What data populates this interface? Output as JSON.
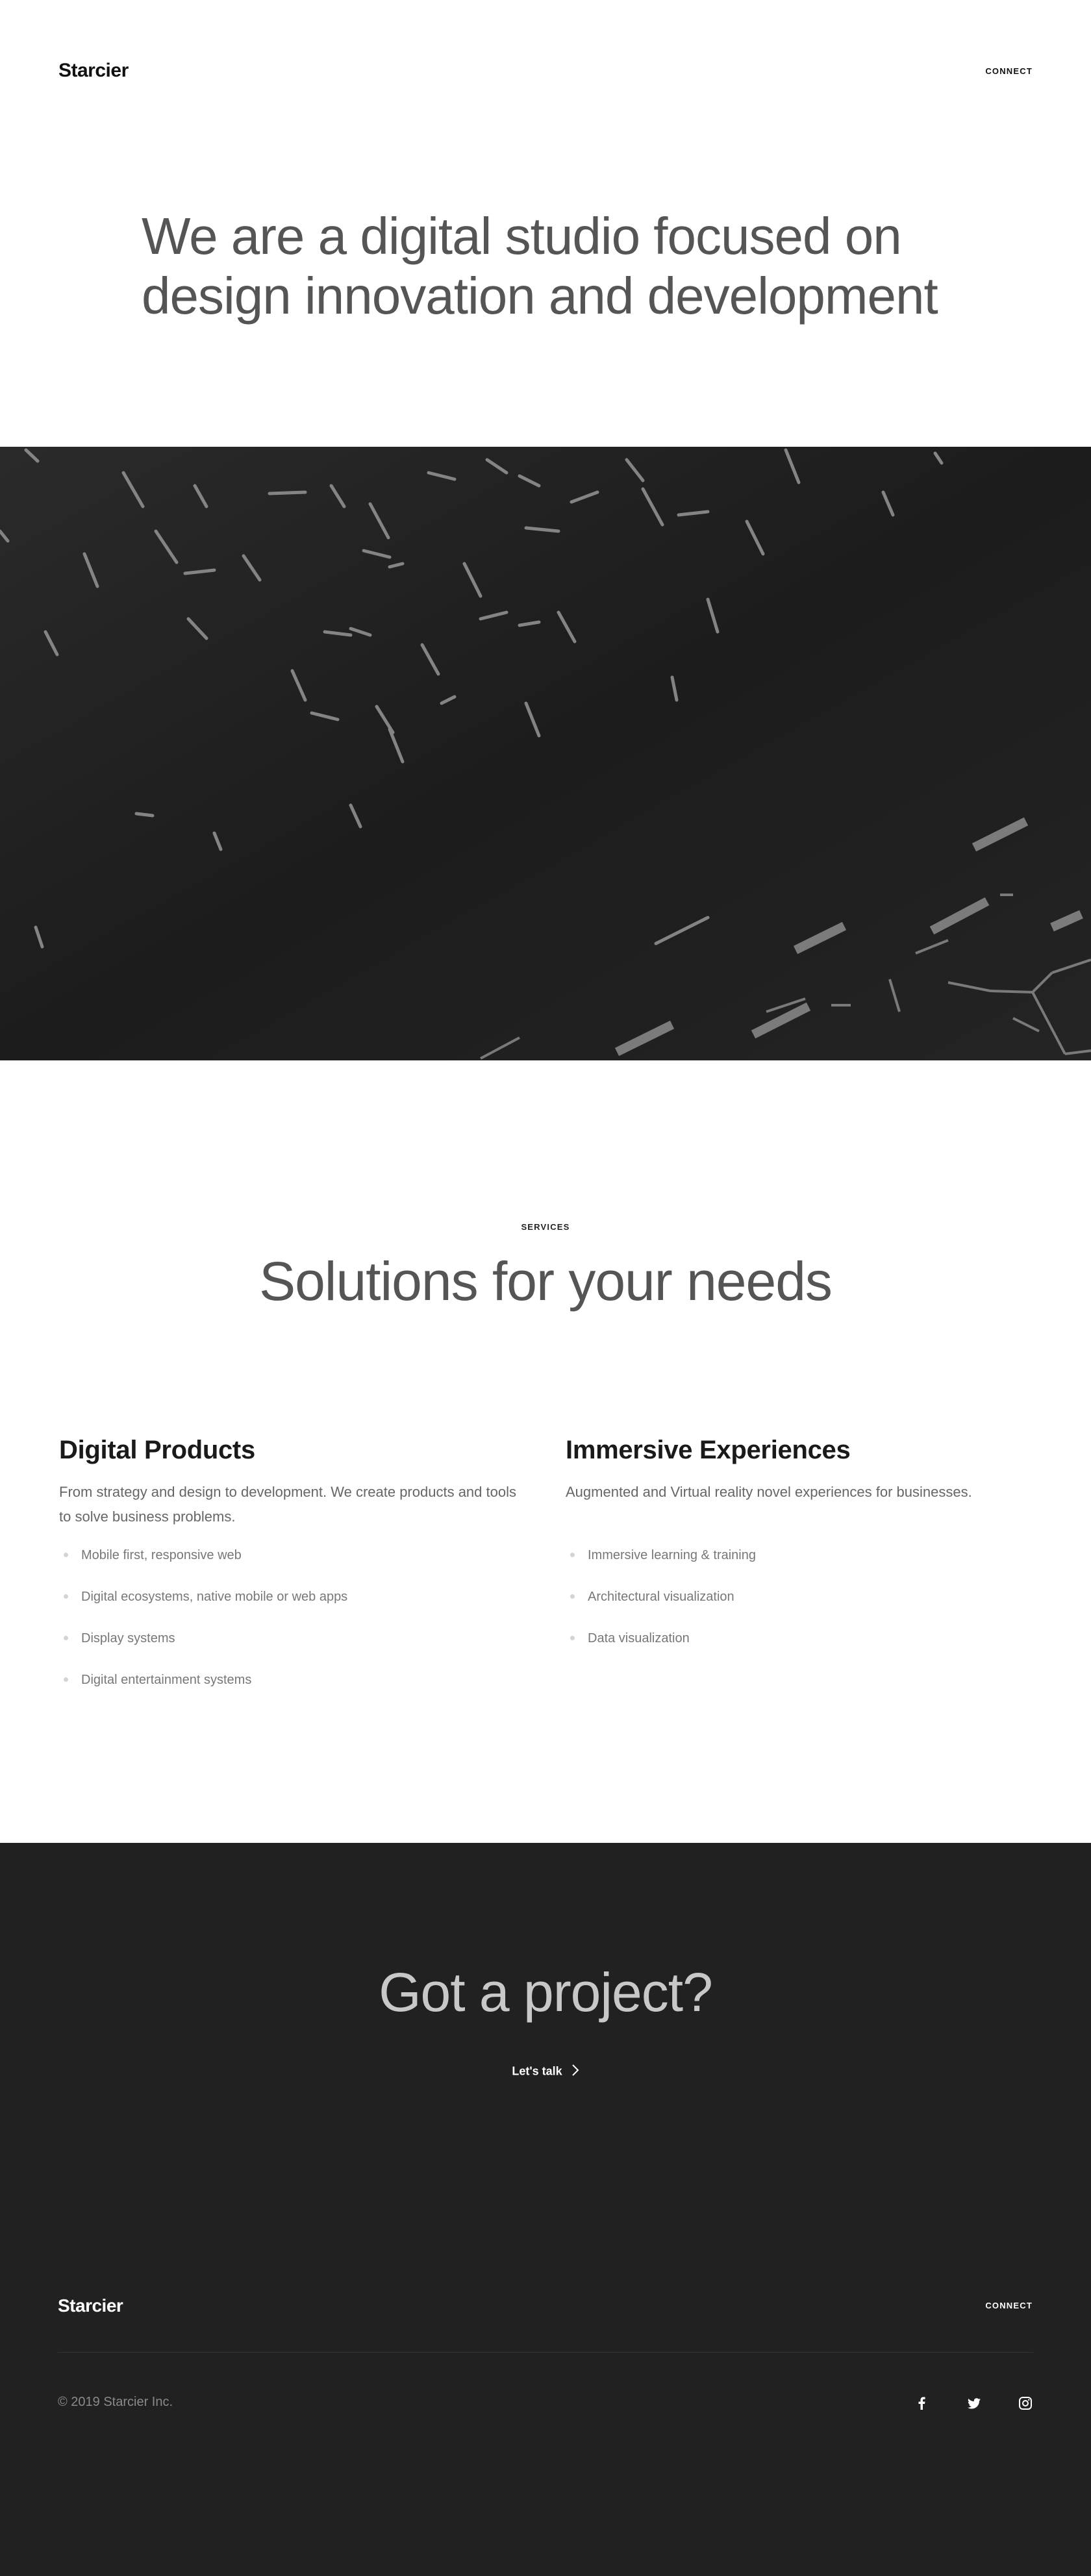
{
  "header": {
    "logo": "Starcier",
    "connect": "CONNECT"
  },
  "hero": {
    "line1": "We are a digital studio focused on",
    "line2": "design innovation and development"
  },
  "services": {
    "eyebrow": "SERVICES",
    "title": "Solutions for your needs",
    "columns": [
      {
        "title": "Digital Products",
        "description": "From strategy and design to development. We create products and tools to solve business problems.",
        "items": [
          "Mobile first, responsive web",
          "Digital ecosystems, native mobile or web apps",
          "Display systems",
          "Digital entertainment systems"
        ]
      },
      {
        "title": "Immersive Experiences",
        "description": "Augmented and Virtual reality novel experiences for businesses.",
        "items": [
          "Immersive learning & training",
          "Architectural visualization",
          "Data visualization"
        ]
      }
    ]
  },
  "cta": {
    "title": "Got a project?",
    "link": "Let's talk"
  },
  "footer": {
    "logo": "Starcier",
    "connect": "CONNECT",
    "copyright": "© 2019 Starcier Inc.",
    "social": [
      "facebook-icon",
      "twitter-icon",
      "instagram-icon"
    ]
  },
  "colors": {
    "band_background": "#1e1e1e",
    "footer_background": "#212121",
    "heading_gray": "#555555"
  }
}
